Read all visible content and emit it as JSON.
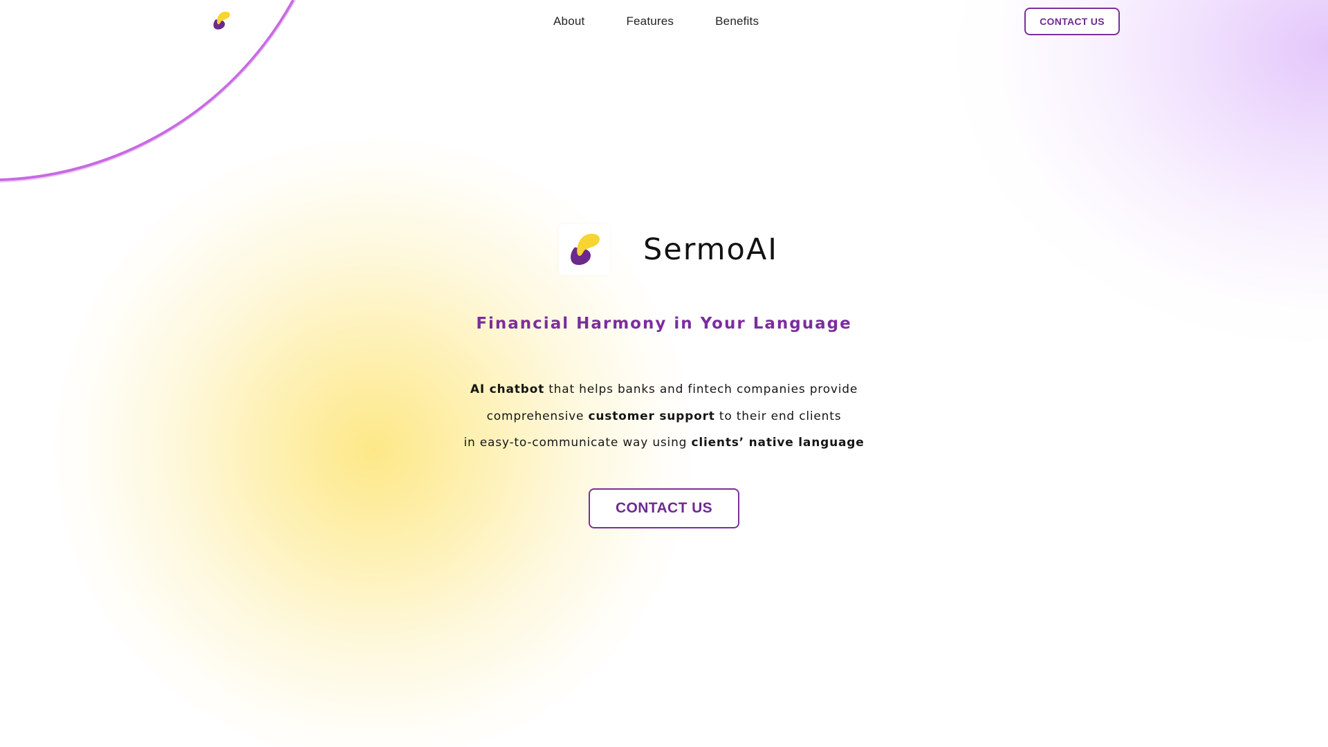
{
  "header": {
    "logo_icon": "sermo-logo-icon",
    "nav": [
      {
        "label": "About"
      },
      {
        "label": "Features"
      },
      {
        "label": "Benefits"
      }
    ],
    "cta_label": "CONTACT US"
  },
  "hero": {
    "brand_name": "SermoAI",
    "logo_icon": "sermo-logo-icon",
    "tagline": "Financial Harmony in Your Language",
    "description": {
      "line1_bold": "AI chatbot",
      "line1_rest": " that helps banks and fintech companies provide",
      "line2_start": "comprehensive ",
      "line2_bold": "customer support",
      "line2_end": " to their end clients",
      "line3_start": "in easy-to-communicate way using ",
      "line3_bold": "clients’ native language"
    },
    "cta_label": "CONTACT US"
  },
  "colors": {
    "accent_purple": "#7a2e9a",
    "logo_yellow": "#f7d531",
    "logo_purple": "#6b2a8c",
    "glow_yellow": "#fde782",
    "glow_purple": "#e2c4fa"
  }
}
